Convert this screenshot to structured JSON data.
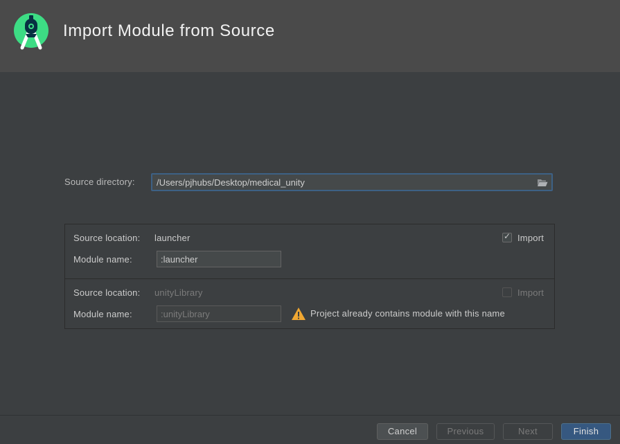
{
  "header": {
    "title": "Import Module from Source",
    "logo_icon": "android-studio-icon"
  },
  "source_directory": {
    "label": "Source directory:",
    "value": "/Users/pjhubs/Desktop/medical_unity",
    "browse_icon": "folder-open-icon"
  },
  "modules": [
    {
      "location_label": "Source location:",
      "location_value": "launcher",
      "name_label": "Module name:",
      "name_value": ":launcher",
      "import_label": "Import",
      "import_checked": true,
      "enabled": true
    },
    {
      "location_label": "Source location:",
      "location_value": "unityLibrary",
      "name_label": "Module name:",
      "name_value": ":unityLibrary",
      "import_label": "Import",
      "import_checked": false,
      "enabled": false,
      "warning_text": "Project already contains module with this name",
      "warning_icon": "warning-icon"
    }
  ],
  "footer": {
    "cancel_label": "Cancel",
    "previous_label": "Previous",
    "next_label": "Next",
    "finish_label": "Finish"
  },
  "colors": {
    "background": "#3c3f41",
    "header_background": "#4a4a4a",
    "accent_blue": "#365880",
    "focus_border": "#3d6185",
    "warning_orange": "#f0a732",
    "android_green": "#3ddc84"
  }
}
